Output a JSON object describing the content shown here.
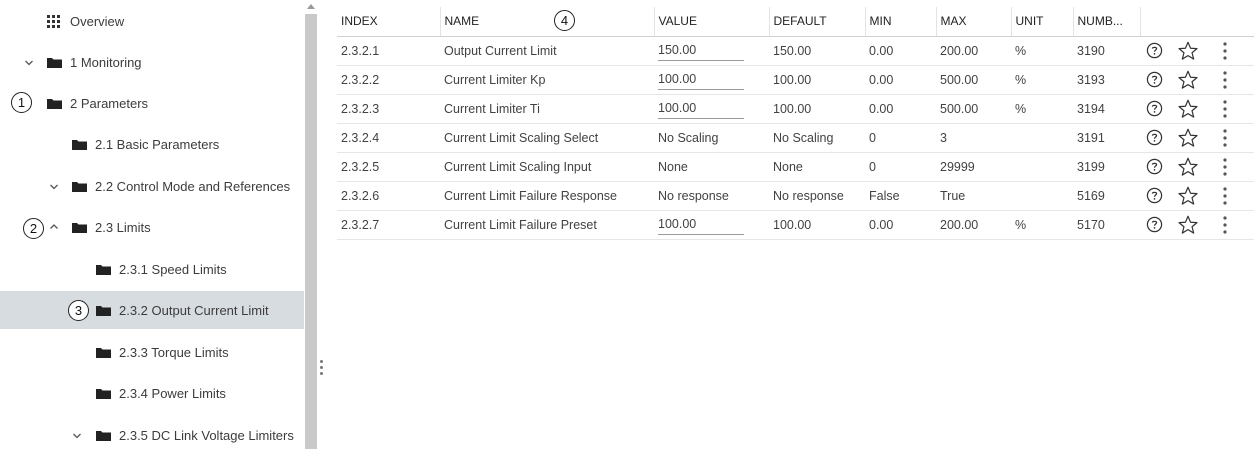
{
  "sidebar": {
    "items": [
      {
        "label": "Overview",
        "icon": "grid-icon"
      },
      {
        "label": "1 Monitoring",
        "icon": "folder-icon",
        "chevron": "chevron-down-icon"
      },
      {
        "label": "2 Parameters",
        "icon": "folder-icon",
        "chevron": "chevron-down-icon"
      },
      {
        "label": "2.1 Basic Parameters",
        "icon": "folder-icon"
      },
      {
        "label": "2.2 Control Mode and References",
        "icon": "folder-icon",
        "chevron": "chevron-down-icon"
      },
      {
        "label": "2.3 Limits",
        "icon": "folder-icon",
        "chevron": "chevron-up-icon"
      },
      {
        "label": "2.3.1 Speed Limits",
        "icon": "folder-icon"
      },
      {
        "label": "2.3.2 Output Current Limit",
        "icon": "folder-icon",
        "selected": true
      },
      {
        "label": "2.3.3 Torque Limits",
        "icon": "folder-icon"
      },
      {
        "label": "2.3.4 Power Limits",
        "icon": "folder-icon"
      },
      {
        "label": "2.3.5 DC Link Voltage Limiters",
        "icon": "folder-icon",
        "chevron": "chevron-down-icon"
      }
    ]
  },
  "callouts": [
    "1",
    "2",
    "3",
    "4"
  ],
  "table": {
    "headers": [
      "INDEX",
      "NAME",
      "VALUE",
      "DEFAULT",
      "MIN",
      "MAX",
      "UNIT",
      "NUMB..."
    ],
    "rows": [
      {
        "index": "2.3.2.1",
        "name": "Output Current Limit",
        "value": "150.00",
        "default": "150.00",
        "min": "0.00",
        "max": "200.00",
        "unit": "%",
        "number": "3190",
        "editable": true
      },
      {
        "index": "2.3.2.2",
        "name": "Current Limiter Kp",
        "value": "100.00",
        "default": "100.00",
        "min": "0.00",
        "max": "500.00",
        "unit": "%",
        "number": "3193",
        "editable": true
      },
      {
        "index": "2.3.2.3",
        "name": "Current Limiter Ti",
        "value": "100.00",
        "default": "100.00",
        "min": "0.00",
        "max": "500.00",
        "unit": "%",
        "number": "3194",
        "editable": true
      },
      {
        "index": "2.3.2.4",
        "name": "Current Limit Scaling Select",
        "value": "No Scaling",
        "default": "No Scaling",
        "min": "0",
        "max": "3",
        "unit": "",
        "number": "3191",
        "editable": false
      },
      {
        "index": "2.3.2.5",
        "name": "Current Limit Scaling Input",
        "value": "None",
        "default": "None",
        "min": "0",
        "max": "29999",
        "unit": "",
        "number": "3199",
        "editable": false
      },
      {
        "index": "2.3.2.6",
        "name": "Current Limit Failure Response",
        "value": "No response",
        "default": "No response",
        "min": "False",
        "max": "True",
        "unit": "",
        "number": "5169",
        "editable": false
      },
      {
        "index": "2.3.2.7",
        "name": "Current Limit Failure Preset",
        "value": "100.00",
        "default": "100.00",
        "min": "0.00",
        "max": "200.00",
        "unit": "%",
        "number": "5170",
        "editable": true
      }
    ],
    "row_actions": [
      "help-icon",
      "star-icon",
      "more-vertical-icon"
    ]
  },
  "colors": {
    "selected_row": "#d7dce1",
    "icon": "#333333",
    "text": "#424242"
  }
}
